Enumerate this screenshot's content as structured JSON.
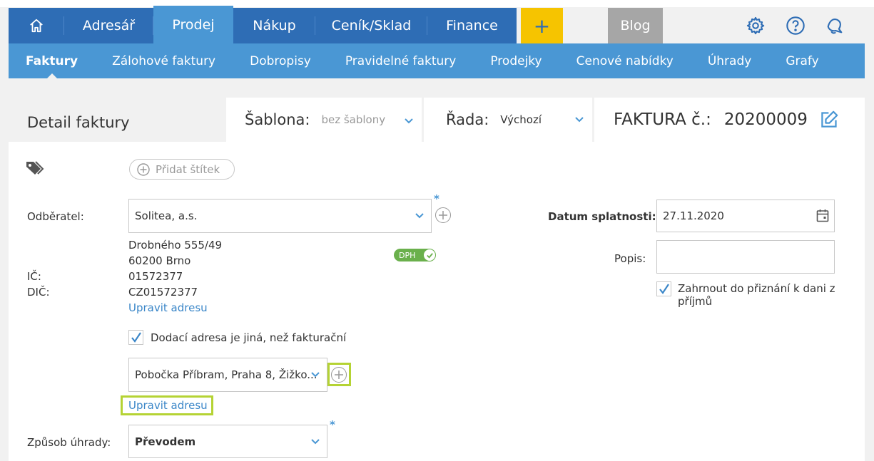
{
  "nav": {
    "home_icon": "home-icon",
    "items": [
      {
        "label": "Adresář"
      },
      {
        "label": "Prodej"
      },
      {
        "label": "Nákup"
      },
      {
        "label": "Ceník/Sklad"
      },
      {
        "label": "Finance"
      }
    ],
    "plus_label": "+",
    "blog_label": "Blog",
    "icons": [
      "gear-icon",
      "help-icon",
      "bell-icon"
    ]
  },
  "subnav": {
    "items": [
      {
        "label": "Faktury"
      },
      {
        "label": "Zálohové faktury"
      },
      {
        "label": "Dobropisy"
      },
      {
        "label": "Pravidelné faktury"
      },
      {
        "label": "Prodejky"
      },
      {
        "label": "Cenové nabídky"
      },
      {
        "label": "Úhrady"
      },
      {
        "label": "Grafy"
      }
    ]
  },
  "header": {
    "title": "Detail faktury",
    "template_label": "Šablona:",
    "template_value": "bez šablony",
    "series_label": "Řada:",
    "series_value": "Výchozí",
    "invoice_label": "FAKTURA č.:",
    "invoice_number": "20200009"
  },
  "form": {
    "add_tag_label": "Přidat štítek",
    "customer_label": "Odběratel:",
    "customer_value": "Solitea, a.s.",
    "required_mark": "*",
    "address_line1": "Drobného 555/49",
    "address_line2": "60200 Brno",
    "ic_label": "IČ:",
    "ic_value": "01572377",
    "dic_label": "DIČ:",
    "dic_value": "CZ01572377",
    "edit_address_label": "Upravit adresu",
    "dph_label": "DPH",
    "delivery_checkbox_label": "Dodací adresa je jiná, než fakturační",
    "delivery_address_value": "Pobočka Příbram, Praha 8, Žižko...",
    "edit_address2_label": "Upravit adresu",
    "payment_label": "Způsob úhrady:",
    "payment_value": "Převodem",
    "due_date_label": "Datum splatnosti:",
    "due_date_value": "27.11.2020",
    "description_label": "Popis:",
    "description_value": "",
    "tax_checkbox_label_1": "Zahrnout do přiznání k dani z",
    "tax_checkbox_label_2": "příjmů"
  },
  "colors": {
    "nav": "#2e6db5",
    "subnav": "#4a97d4",
    "plus": "#f6c400",
    "blog": "#a6a6a6",
    "highlight": "#b5d334",
    "dph": "#6ab04c"
  }
}
